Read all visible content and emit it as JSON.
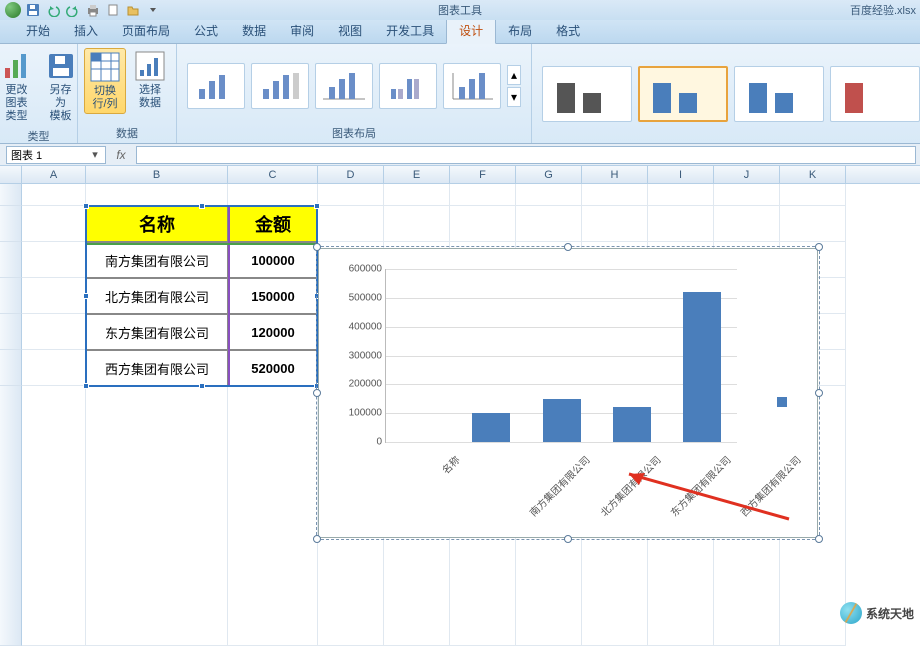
{
  "titlebar": {
    "context_tool": "图表工具",
    "filename": "百度经验.xlsx"
  },
  "tabs": {
    "start": "开始",
    "insert": "插入",
    "page_layout": "页面布局",
    "formula": "公式",
    "data": "数据",
    "review": "审阅",
    "view": "视图",
    "dev": "开发工具",
    "design": "设计",
    "layout": "布局",
    "format": "格式"
  },
  "ribbon": {
    "group_type": {
      "label": "类型",
      "change_type": "更改\n图表类型",
      "save_template": "另存为\n模板"
    },
    "group_data": {
      "label": "数据",
      "switch": "切换行/列",
      "select": "选择数据"
    },
    "group_layout": {
      "label": "图表布局"
    }
  },
  "namebox": {
    "value": "图表 1"
  },
  "columns": [
    "A",
    "B",
    "C",
    "D",
    "E",
    "F",
    "G",
    "H",
    "I",
    "J",
    "K"
  ],
  "headers": {
    "name": "名称",
    "amount": "金额"
  },
  "companies": [
    {
      "name": "南方集团有限公司",
      "amount": "100000"
    },
    {
      "name": "北方集团有限公司",
      "amount": "150000"
    },
    {
      "name": "东方集团有限公司",
      "amount": "120000"
    },
    {
      "name": "西方集团有限公司",
      "amount": "520000"
    }
  ],
  "chart_data": {
    "type": "bar",
    "categories": [
      "名称",
      "南方集团有限公司",
      "北方集团有限公司",
      "东方集团有限公司",
      "西方集团有限公司"
    ],
    "values": [
      0,
      100000,
      150000,
      120000,
      520000
    ],
    "title": "",
    "xlabel": "",
    "ylabel": "",
    "ylim": [
      0,
      600000
    ],
    "yticks": [
      0,
      100000,
      200000,
      300000,
      400000,
      500000,
      600000
    ]
  },
  "watermark": "系统天地"
}
